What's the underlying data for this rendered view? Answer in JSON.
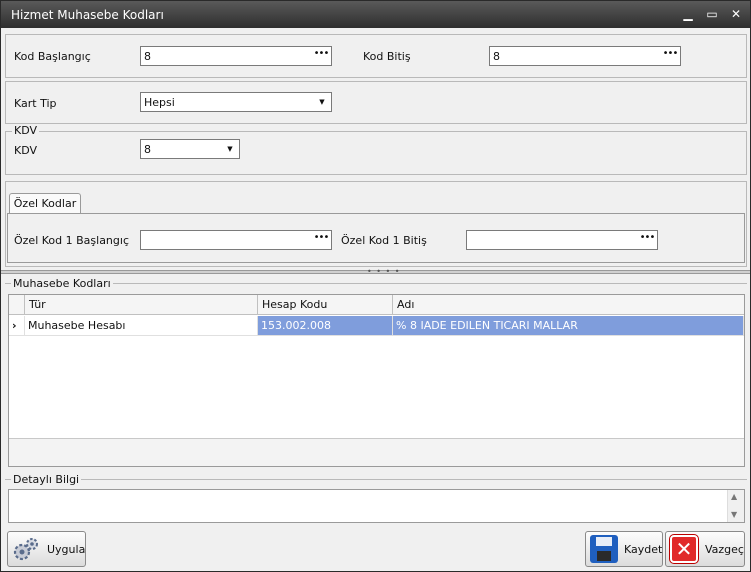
{
  "window": {
    "title": "Hizmet Muhasebe Kodları"
  },
  "filters": {
    "kod_baslangic_label": "Kod Başlangıç",
    "kod_baslangic_value": "8",
    "kod_bitis_label": "Kod Bitiş",
    "kod_bitis_value": "8",
    "kart_tip_label": "Kart Tip",
    "kart_tip_value": "Hepsi"
  },
  "kdv": {
    "group_title": "KDV",
    "label": "KDV",
    "value": "8"
  },
  "ozel_kodlar": {
    "tab_label": "Özel Kodlar",
    "baslangic_label": "Özel Kod 1 Başlangıç",
    "baslangic_value": "",
    "bitis_label": "Özel Kod 1 Bitiş",
    "bitis_value": ""
  },
  "muhasebe": {
    "group_title": "Muhasebe Kodları",
    "columns": [
      "Tür",
      "Hesap Kodu",
      "Adı"
    ],
    "rows": [
      [
        "Muhasebe Hesabı",
        "153.002.008",
        "% 8 IADE EDILEN TICARI MALLAR"
      ]
    ]
  },
  "detay": {
    "group_title": "Detaylı Bilgi",
    "value": ""
  },
  "buttons": {
    "uygula": "Uygula",
    "kaydet": "Kaydet",
    "vazgec": "Vazgeç"
  },
  "icons": {
    "ellipsis": "…",
    "dropdown": "chevron-down-icon",
    "row_indicator": "›"
  }
}
